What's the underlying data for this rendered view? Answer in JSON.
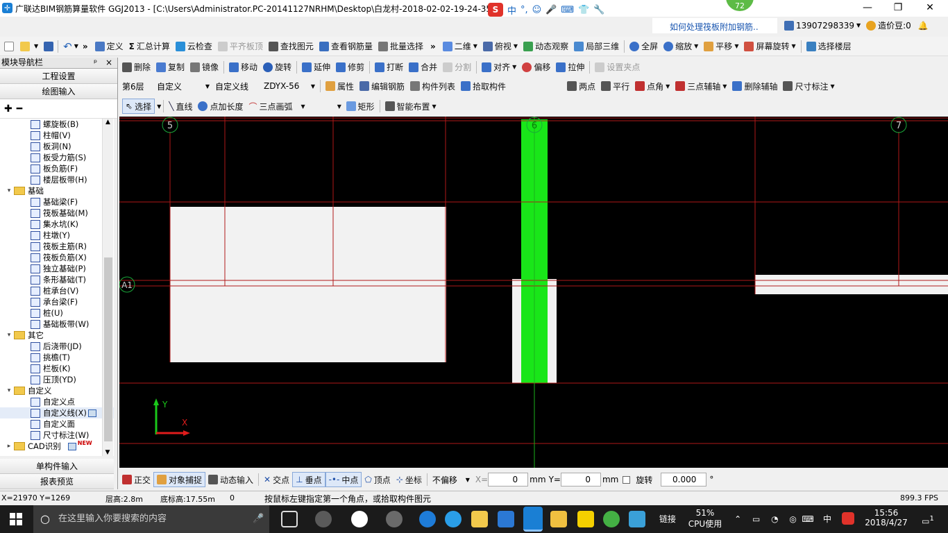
{
  "window": {
    "title": "广联达BIM钢筋算量软件 GGJ2013 - [C:\\Users\\Administrator.PC-20141127NRHM\\Desktop\\白龙村-2018-02-02-19-24-35",
    "badge": "72",
    "ime_label": "中",
    "help_link": "如何处理筏板附加钢筋..",
    "user_phone": "13907298339",
    "coins": "造价豆:0"
  },
  "toolbar1": {
    "items": [
      "定义",
      "汇总计算",
      "云检查",
      "平齐板顶",
      "查找图元",
      "查看钢筋量",
      "批量选择",
      "二维",
      "俯视",
      "动态观察",
      "局部三维",
      "全屏",
      "缩放",
      "平移",
      "屏幕旋转",
      "选择楼层"
    ]
  },
  "toolbar2": {
    "items": [
      "删除",
      "复制",
      "镜像",
      "移动",
      "旋转",
      "延伸",
      "修剪",
      "打断",
      "合并",
      "分割",
      "对齐",
      "偏移",
      "拉伸",
      "设置夹点"
    ]
  },
  "toolbar3": {
    "floor": "第6层",
    "category": "自定义",
    "type": "自定义线",
    "component": "ZDYX-56",
    "items": [
      "属性",
      "编辑钢筋",
      "构件列表",
      "拾取构件"
    ],
    "axis_items": [
      "两点",
      "平行",
      "点角",
      "三点辅轴",
      "删除辅轴",
      "尺寸标注"
    ]
  },
  "toolbar4": {
    "items": [
      "选择",
      "直线",
      "点加长度",
      "三点画弧",
      "矩形",
      "智能布置"
    ]
  },
  "sidebar": {
    "header": "模块导航栏",
    "pin": "ᵖ",
    "close": "×",
    "sections": [
      "工程设置",
      "绘图输入"
    ],
    "bottom_sections": [
      "单构件输入",
      "报表预览"
    ],
    "tree": [
      {
        "label": "螺旋板(B)",
        "level": 2
      },
      {
        "label": "柱帽(V)",
        "level": 2
      },
      {
        "label": "板洞(N)",
        "level": 2
      },
      {
        "label": "板受力筋(S)",
        "level": 2
      },
      {
        "label": "板负筋(F)",
        "level": 2
      },
      {
        "label": "楼层板带(H)",
        "level": 2
      },
      {
        "label": "基础",
        "level": 1
      },
      {
        "label": "基础梁(F)",
        "level": 2
      },
      {
        "label": "筏板基础(M)",
        "level": 2
      },
      {
        "label": "集水坑(K)",
        "level": 2
      },
      {
        "label": "柱墩(Y)",
        "level": 2
      },
      {
        "label": "筏板主筋(R)",
        "level": 2
      },
      {
        "label": "筏板负筋(X)",
        "level": 2
      },
      {
        "label": "独立基础(P)",
        "level": 2
      },
      {
        "label": "条形基础(T)",
        "level": 2
      },
      {
        "label": "桩承台(V)",
        "level": 2
      },
      {
        "label": "承台梁(F)",
        "level": 2
      },
      {
        "label": "桩(U)",
        "level": 2
      },
      {
        "label": "基础板带(W)",
        "level": 2
      },
      {
        "label": "其它",
        "level": 1
      },
      {
        "label": "后浇带(JD)",
        "level": 2
      },
      {
        "label": "挑檐(T)",
        "level": 2
      },
      {
        "label": "栏板(K)",
        "level": 2
      },
      {
        "label": "压顶(YD)",
        "level": 2
      },
      {
        "label": "自定义",
        "level": 1
      },
      {
        "label": "自定义点",
        "level": 2
      },
      {
        "label": "自定义线(X)",
        "level": 2
      },
      {
        "label": "自定义面",
        "level": 2
      },
      {
        "label": "尺寸标注(W)",
        "level": 2
      },
      {
        "label": "CAD识别",
        "level": 1
      }
    ],
    "new_badge": "NEW"
  },
  "canvas": {
    "axis_labels": [
      "5",
      "6",
      "7",
      "A1"
    ],
    "y_label": "Y",
    "x_label": "X"
  },
  "bottom": {
    "items": [
      "正交",
      "对象捕捉",
      "动态输入",
      "交点",
      "垂点",
      "中点",
      "顶点",
      "坐标"
    ],
    "offset_mode": "不偏移",
    "x_label": "X=",
    "x_value": "0",
    "y_label": "Y=",
    "y_value": "0",
    "unit": "mm",
    "rotate_label": "旋转",
    "rotate_value": "0.000",
    "degree": "°"
  },
  "status": {
    "coords": "X=21970 Y=1269",
    "floor_height": "层高:2.8m",
    "base_height": "底标高:17.55m",
    "zero": "0",
    "hint": "按鼠标左键指定第一个角点，或拾取构件图元",
    "fps": "899.3 FPS"
  },
  "taskbar": {
    "search_placeholder": "在这里输入你要搜索的内容",
    "link": "链接",
    "cpu_percent": "51%",
    "cpu_label": "CPU使用",
    "ime": "中",
    "time": "15:56",
    "date": "2018/4/27",
    "notifications": "1"
  },
  "colors": {
    "canvas_bg": "#000000",
    "grid_line": "#b01818",
    "green_strip": "#19e619",
    "slab_fill": "#f2f2f2",
    "axis_circle": "#1aa83a"
  }
}
